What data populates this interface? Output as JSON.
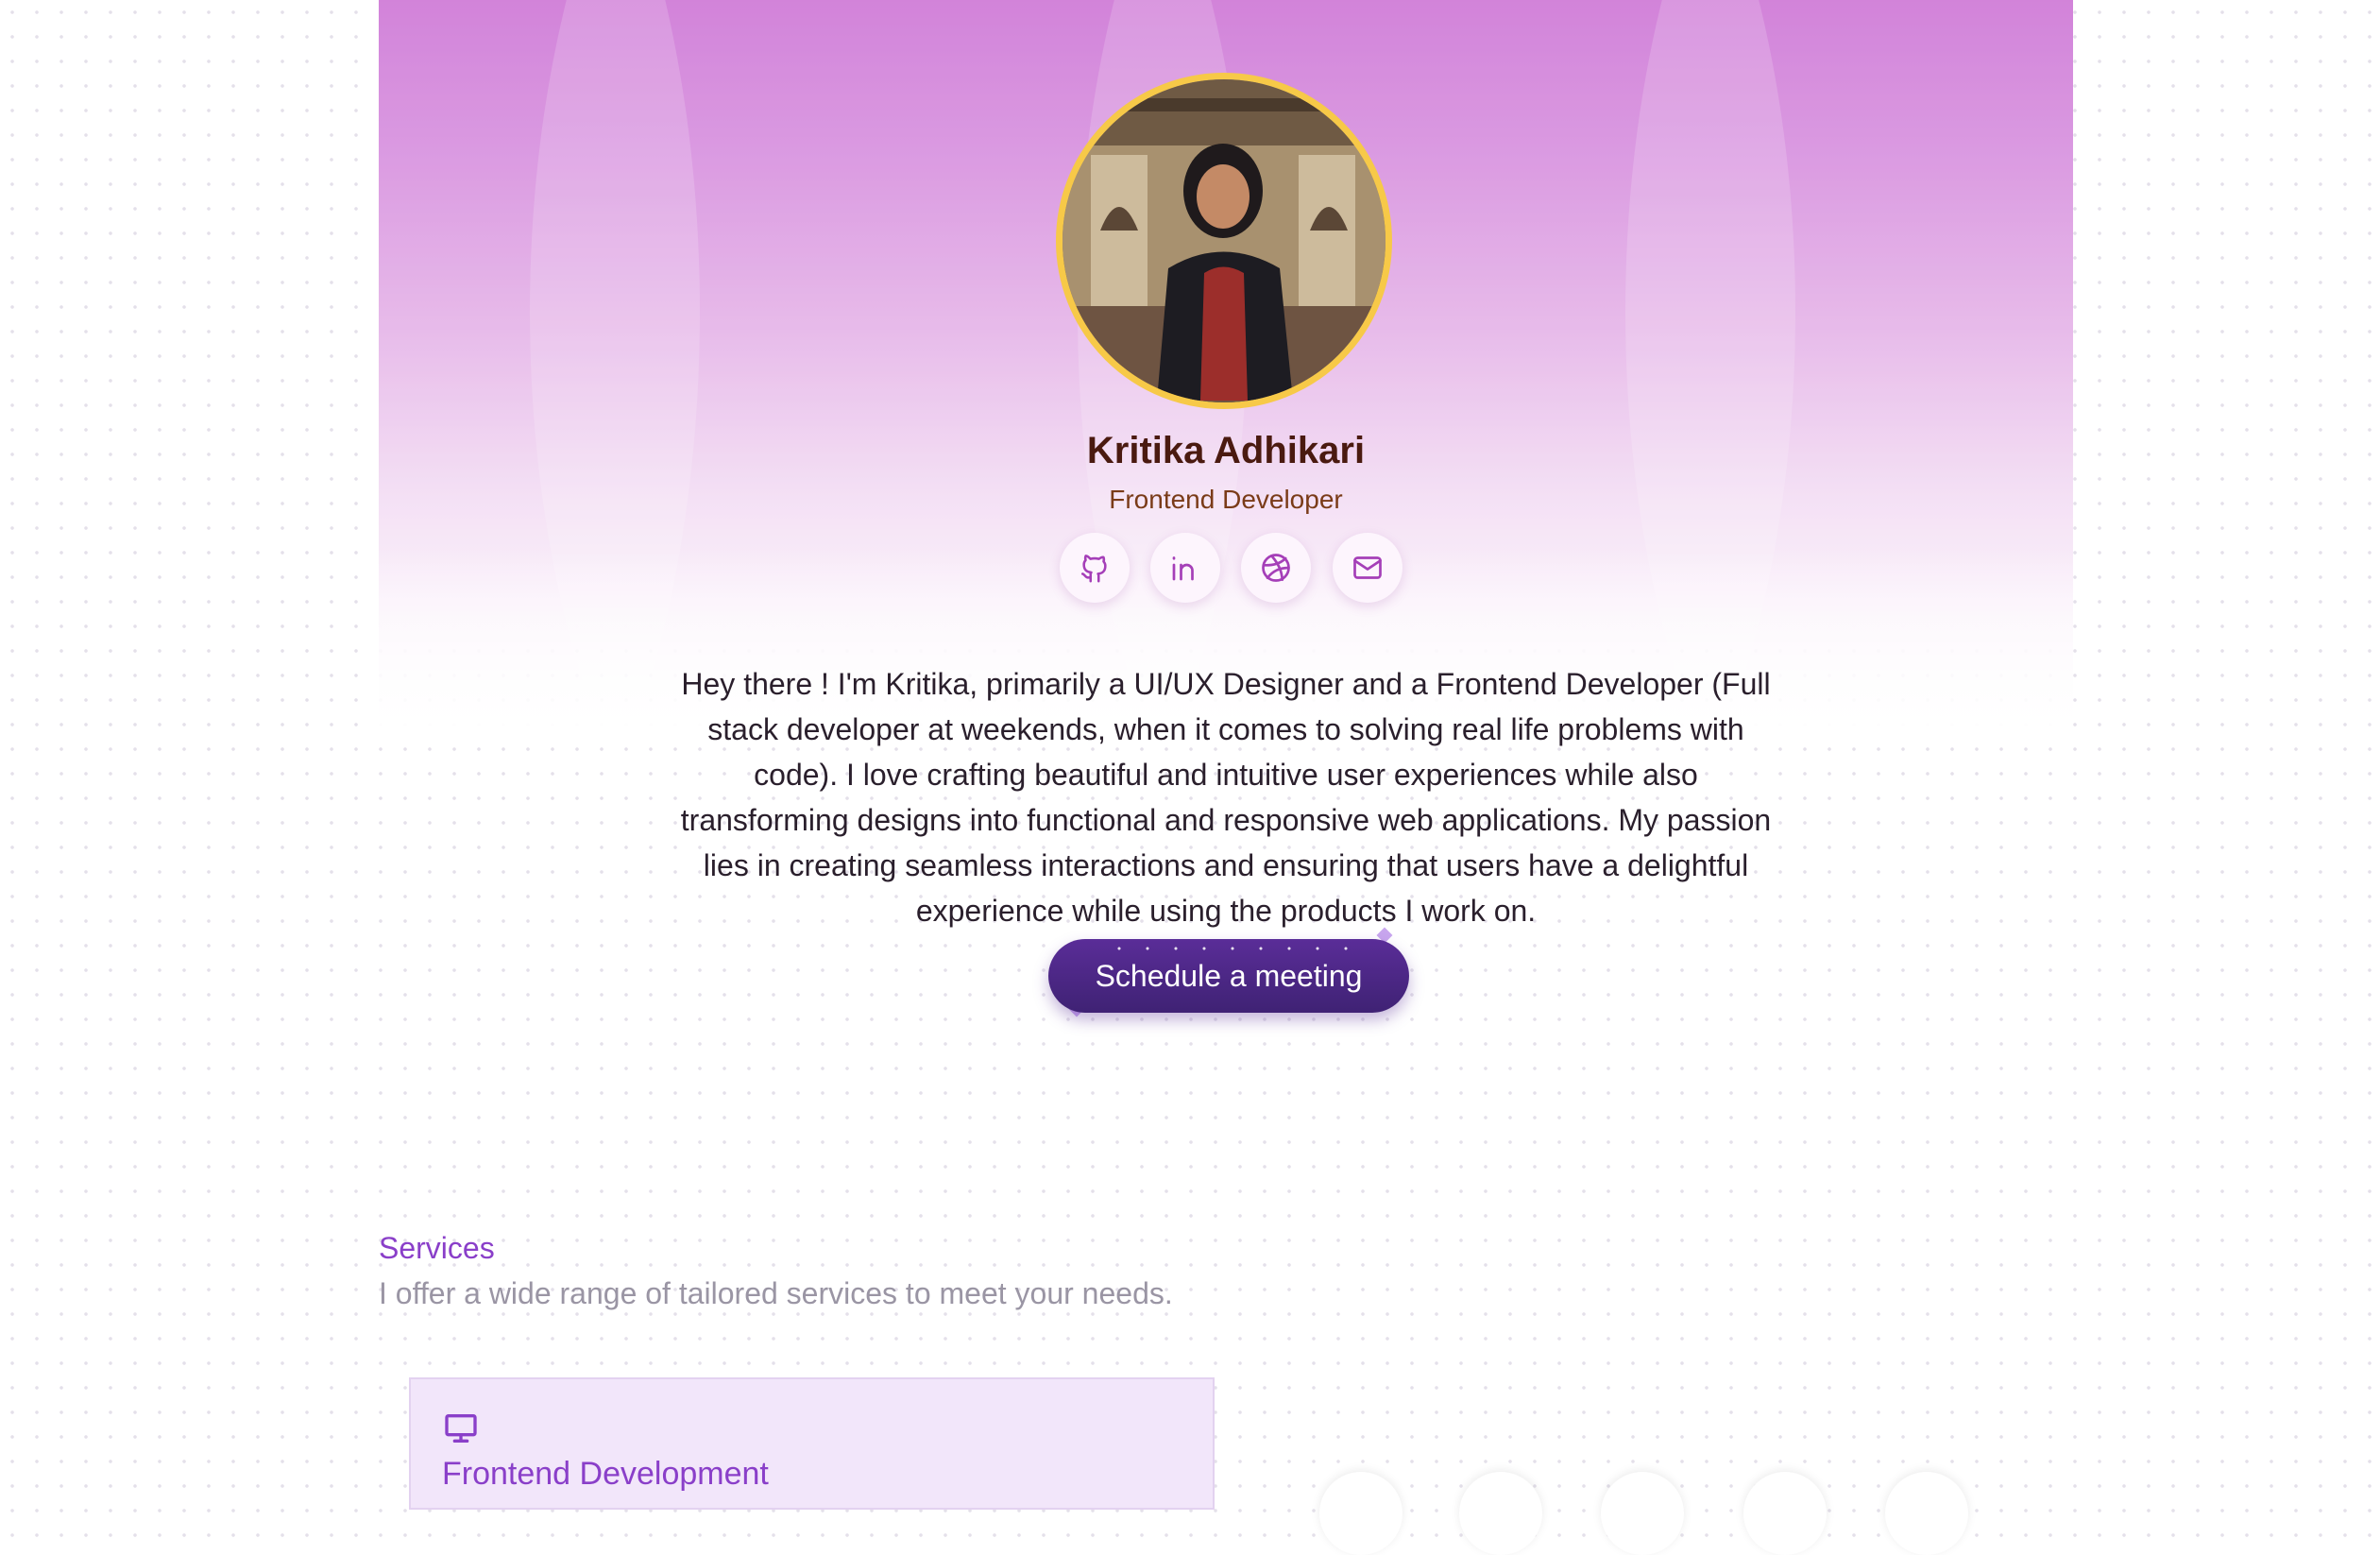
{
  "profile": {
    "name": "Kritika Adhikari",
    "role": "Frontend Developer",
    "bio": "Hey there ! I'm Kritika, primarily a UI/UX Designer and a Frontend Developer (Full stack developer at weekends, when it comes to solving real life problems with code). I love crafting beautiful and intuitive user experiences while also transforming designs into functional and responsive web applications. My passion lies in creating seamless interactions and ensuring that users have a delightful experience while using the products I work on.",
    "cta_label": "Schedule a meeting"
  },
  "social_links": [
    {
      "icon": "github-icon"
    },
    {
      "icon": "linkedin-icon"
    },
    {
      "icon": "dribbble-icon"
    },
    {
      "icon": "mail-icon"
    }
  ],
  "services": {
    "title": "Services",
    "subtitle": "I offer a wide range of tailored services to meet your needs.",
    "items": [
      {
        "title": "Frontend Development",
        "icon": "monitor-icon"
      }
    ]
  },
  "colors": {
    "accent": "#8a3fc9",
    "hero_top": "#c96ad2",
    "avatar_ring": "#f7c948",
    "cta": "#4a2585",
    "name_text": "#4a1a10"
  }
}
